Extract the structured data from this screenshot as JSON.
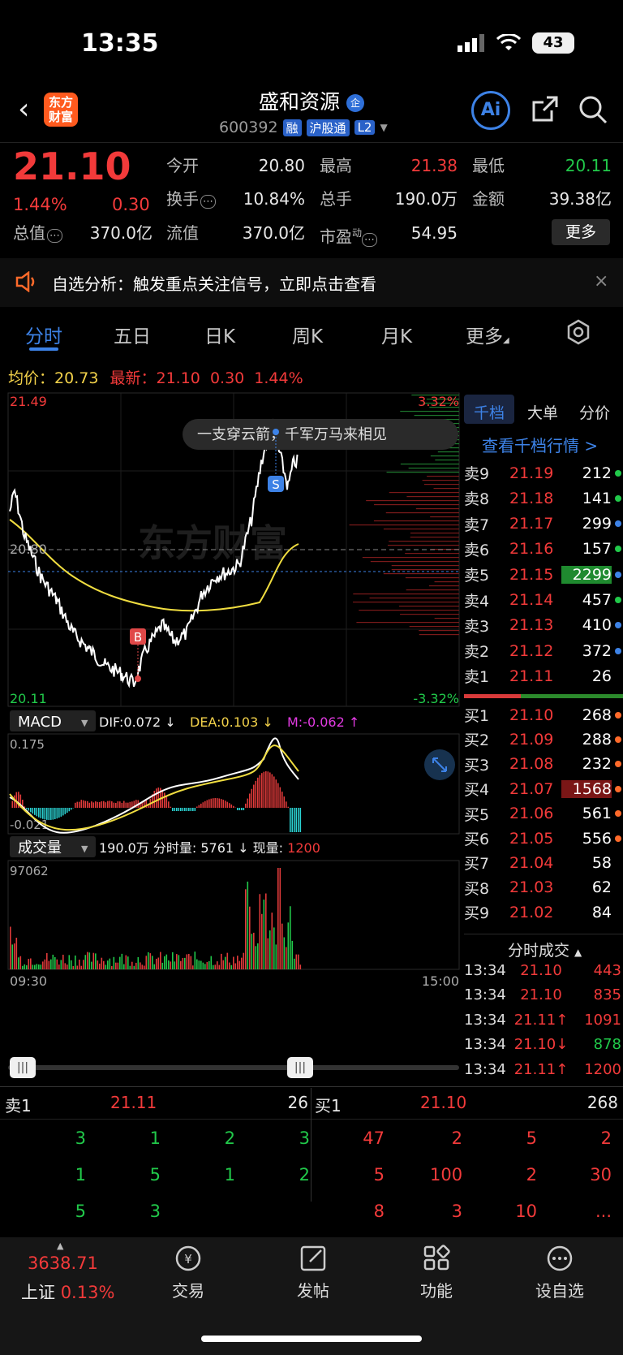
{
  "status_bar": {
    "time": "13:35",
    "battery": "43"
  },
  "header": {
    "logo": "东方财富",
    "stock_name": "盛和资源",
    "name_badge": "企",
    "code": "600392",
    "tags": [
      "融",
      "沪股通",
      "L2"
    ]
  },
  "quote": {
    "price": "21.10",
    "pct": "1.44%",
    "change": "0.30",
    "cells": [
      {
        "label": "今开",
        "value": "20.80"
      },
      {
        "label": "最高",
        "value": "21.38"
      },
      {
        "label": "最低",
        "value": "20.11"
      },
      {
        "label": "换手",
        "value": "10.84%"
      },
      {
        "label": "总手",
        "value": "190.0万"
      },
      {
        "label": "金额",
        "value": "39.38亿"
      },
      {
        "label": "总值",
        "value": "370.0亿"
      },
      {
        "label": "流值",
        "value": "370.0亿"
      },
      {
        "label": "市盈",
        "sup": "动",
        "value": "54.95"
      }
    ],
    "more_label": "更多"
  },
  "notice": {
    "text": "自选分析：触发重点关注信号，立即点击查看",
    "close": "×"
  },
  "tabs": [
    "分时",
    "五日",
    "日K",
    "周K",
    "月K",
    "更多"
  ],
  "avg_line": {
    "avg_label": "均价：",
    "avg": "20.73",
    "last_label": "最新：",
    "last": "21.10",
    "chg": "0.30",
    "pct": "1.44%"
  },
  "chart": {
    "top_price": "21.49",
    "mid_price": "20.80",
    "bottom_price": "20.11",
    "top_pct": "3.32%",
    "bottom_pct": "-3.32%",
    "watermark": "东方财富",
    "toast": "一支穿云箭，千军万马来相见",
    "buy_marker": "B",
    "sell_marker": "S",
    "macd_label": "MACD",
    "dif": "DIF:0.072 ↓",
    "dea": "DEA:0.103 ↓",
    "m": "M:-0.062 ↑",
    "macd_top": "0.175",
    "macd_bottom": "-0.021",
    "vol_label": "成交量",
    "vol_info": "190.0万 分时量: 5761 ↓ 现量: ",
    "vol_now": "1200",
    "vol_top": "97062",
    "time_start": "09:30",
    "time_end": "15:00"
  },
  "right_panel": {
    "tabs": [
      "千档",
      "大单",
      "分价"
    ],
    "view_link": "查看千档行情 >",
    "asks": [
      {
        "label": "卖9",
        "price": "21.19",
        "vol": "212"
      },
      {
        "label": "卖8",
        "price": "21.18",
        "vol": "141"
      },
      {
        "label": "卖7",
        "price": "21.17",
        "vol": "299"
      },
      {
        "label": "卖6",
        "price": "21.16",
        "vol": "157"
      },
      {
        "label": "卖5",
        "price": "21.15",
        "vol": "2299"
      },
      {
        "label": "卖4",
        "price": "21.14",
        "vol": "457"
      },
      {
        "label": "卖3",
        "price": "21.13",
        "vol": "410"
      },
      {
        "label": "卖2",
        "price": "21.12",
        "vol": "372"
      },
      {
        "label": "卖1",
        "price": "21.11",
        "vol": "26"
      }
    ],
    "bids": [
      {
        "label": "买1",
        "price": "21.10",
        "vol": "268"
      },
      {
        "label": "买2",
        "price": "21.09",
        "vol": "288"
      },
      {
        "label": "买3",
        "price": "21.08",
        "vol": "232"
      },
      {
        "label": "买4",
        "price": "21.07",
        "vol": "1568"
      },
      {
        "label": "买5",
        "price": "21.06",
        "vol": "561"
      },
      {
        "label": "买6",
        "price": "21.05",
        "vol": "556"
      },
      {
        "label": "买7",
        "price": "21.04",
        "vol": "58"
      },
      {
        "label": "买8",
        "price": "21.03",
        "vol": "62"
      },
      {
        "label": "买9",
        "price": "21.02",
        "vol": "84"
      }
    ],
    "trades_title": "分时成交",
    "trades": [
      {
        "time": "13:34",
        "price": "21.10",
        "vol": "443"
      },
      {
        "time": "13:34",
        "price": "21.10",
        "vol": "835"
      },
      {
        "time": "13:34",
        "price": "21.11↑",
        "vol": "1091"
      },
      {
        "time": "13:34",
        "price": "21.10↓",
        "vol": "878"
      },
      {
        "time": "13:34",
        "price": "21.11↑",
        "vol": "1200"
      }
    ]
  },
  "queue": {
    "sell_label": "卖1",
    "sell_price": "21.11",
    "sell_vol": "26",
    "buy_label": "买1",
    "buy_price": "21.10",
    "buy_vol": "268",
    "sell_rows": [
      [
        "3",
        "1",
        "2",
        "3"
      ],
      [
        "1",
        "5",
        "1",
        "2"
      ],
      [
        "5",
        "3",
        "",
        ""
      ]
    ],
    "buy_rows": [
      [
        "47",
        "2",
        "5",
        "2"
      ],
      [
        "5",
        "100",
        "2",
        "30"
      ],
      [
        "8",
        "3",
        "10",
        "..."
      ]
    ]
  },
  "bottom_nav": {
    "index_value": "3638.71",
    "index_name": "上证",
    "index_pct": "0.13%",
    "items": [
      "交易",
      "发帖",
      "功能",
      "设自选"
    ]
  }
}
